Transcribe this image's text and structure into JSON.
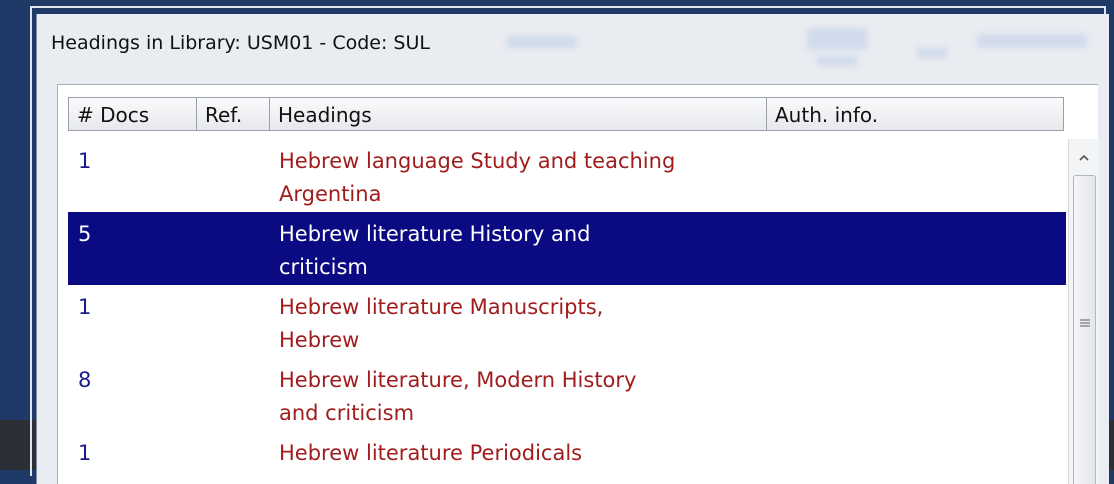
{
  "window": {
    "title": "Headings in Library: USM01 - Code: SUL"
  },
  "table": {
    "columns": [
      "# Docs",
      "Ref.",
      "Headings",
      "Auth. info."
    ],
    "rows": [
      {
        "docs": "1",
        "ref": "",
        "heading": "Hebrew language Study and teaching\nArgentina",
        "auth": "",
        "selected": false
      },
      {
        "docs": "5",
        "ref": "",
        "heading": "Hebrew literature History and\ncriticism",
        "auth": "",
        "selected": true
      },
      {
        "docs": "1",
        "ref": "",
        "heading": "Hebrew literature Manuscripts,\nHebrew",
        "auth": "",
        "selected": false
      },
      {
        "docs": "8",
        "ref": "",
        "heading": "Hebrew literature, Modern History\nand criticism",
        "auth": "",
        "selected": false
      },
      {
        "docs": "1",
        "ref": "",
        "heading": "Hebrew literature Periodicals",
        "auth": "",
        "selected": false
      }
    ]
  },
  "scrollbar": {
    "up_icon": "chevron-up-icon",
    "grip_icon": "grip-lines-icon"
  },
  "colors": {
    "selection": "#0a0a83",
    "heading_text": "#a11d1d",
    "docs_text": "#1a1a8a",
    "frame": "#1f3a66"
  }
}
